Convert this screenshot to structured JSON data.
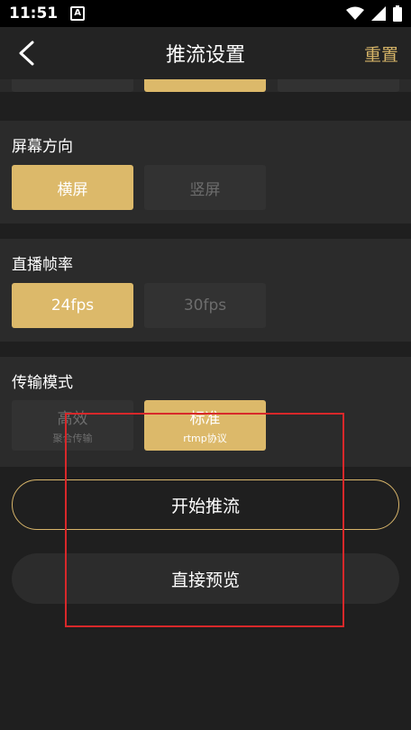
{
  "status_bar": {
    "time": "11:51",
    "notification_icon": "A"
  },
  "header": {
    "title": "推流设置",
    "reset_label": "重置"
  },
  "sections": {
    "orientation": {
      "label": "屏幕方向",
      "options": [
        "横屏",
        "竖屏"
      ],
      "selected": "横屏"
    },
    "framerate": {
      "label": "直播帧率",
      "options": [
        "24fps",
        "30fps"
      ],
      "selected": "24fps"
    },
    "transport": {
      "label": "传输模式",
      "options": [
        {
          "title": "高效",
          "subtitle": "聚合传输"
        },
        {
          "title": "标准",
          "subtitle": "rtmp协议"
        }
      ],
      "selected": "标准"
    }
  },
  "actions": {
    "start_label": "开始推流",
    "preview_label": "直接预览"
  },
  "colors": {
    "accent": "#dcb96a",
    "background": "#1f1f1f",
    "panel": "#2b2b2b",
    "annotation": "#d8282a"
  }
}
